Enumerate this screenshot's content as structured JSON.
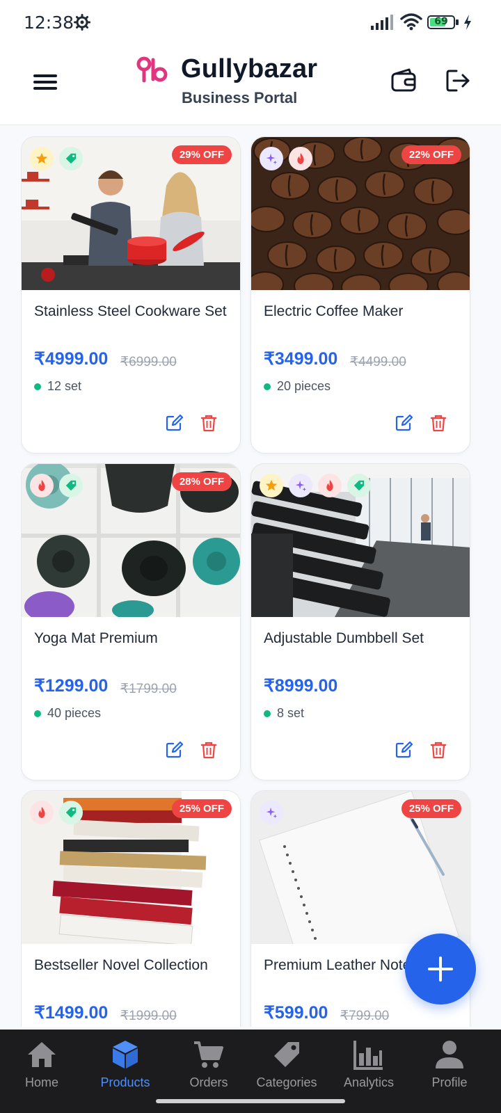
{
  "status_bar": {
    "time": "12:38",
    "battery": "69",
    "battery_level": 0.69
  },
  "header": {
    "brand_name": "Gullybazar",
    "brand_subtitle": "Business Portal"
  },
  "products": [
    {
      "title": "Stainless Steel Cookware Set",
      "price": "₹4999.00",
      "mrp": "₹6999.00",
      "discount": "29% OFF",
      "stock": "12 set",
      "tags": [
        "star",
        "deal"
      ]
    },
    {
      "title": "Electric Coffee Maker",
      "price": "₹3499.00",
      "mrp": "₹4499.00",
      "discount": "22% OFF",
      "stock": "20 pieces",
      "tags": [
        "spark",
        "hot"
      ]
    },
    {
      "title": "Yoga Mat Premium",
      "price": "₹1299.00",
      "mrp": "₹1799.00",
      "discount": "28% OFF",
      "stock": "40 pieces",
      "tags": [
        "hot",
        "deal"
      ]
    },
    {
      "title": "Adjustable Dumbbell Set",
      "price": "₹8999.00",
      "mrp": "",
      "discount": "",
      "stock": "8 set",
      "tags": [
        "star",
        "spark",
        "hot",
        "deal"
      ]
    },
    {
      "title": "Bestseller Novel Collection",
      "price": "₹1499.00",
      "mrp": "₹1999.00",
      "discount": "25% OFF",
      "stock": "",
      "tags": [
        "hot",
        "deal"
      ]
    },
    {
      "title": "Premium Leather Notebook",
      "price": "₹599.00",
      "mrp": "₹799.00",
      "discount": "25% OFF",
      "stock": "",
      "tags": [
        "spark"
      ]
    }
  ],
  "bottom_nav": [
    {
      "label": "Home",
      "icon": "home-icon"
    },
    {
      "label": "Products",
      "icon": "cube-icon",
      "active": true
    },
    {
      "label": "Orders",
      "icon": "cart-icon"
    },
    {
      "label": "Categories",
      "icon": "tag-icon"
    },
    {
      "label": "Analytics",
      "icon": "bar-chart-icon"
    },
    {
      "label": "Profile",
      "icon": "user-icon"
    }
  ],
  "colors": {
    "accent": "#2563eb",
    "discount": "#ef4444",
    "in_stock": "#10b981",
    "nav_bg": "#1c1c1e"
  }
}
